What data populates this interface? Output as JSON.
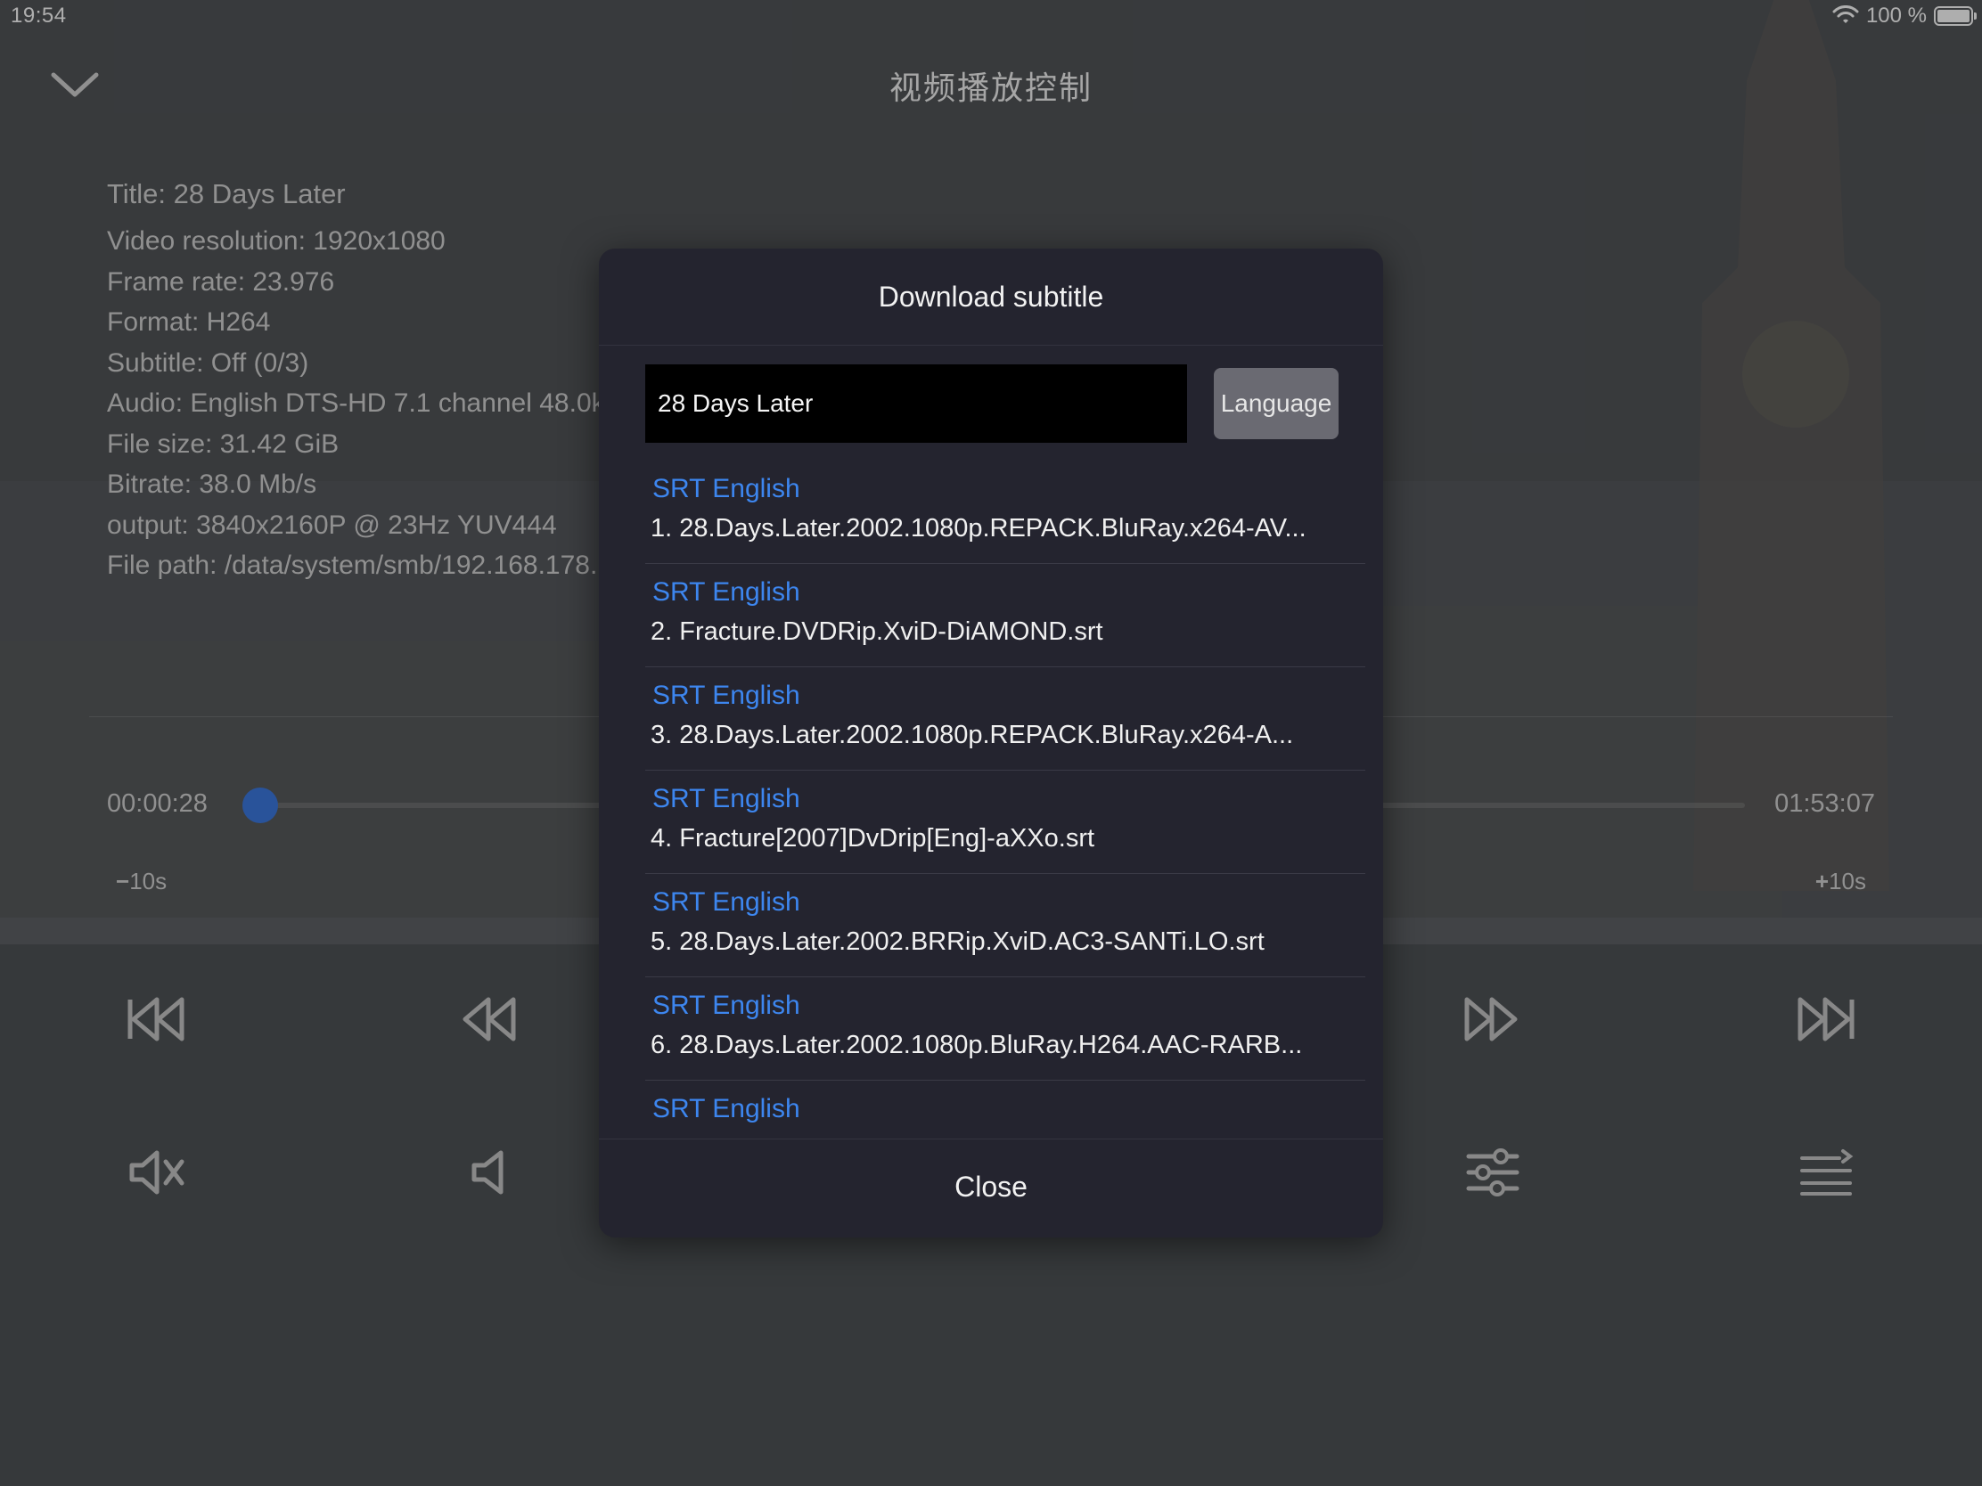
{
  "status_bar": {
    "time": "19:54",
    "battery_text": "100 %"
  },
  "header": {
    "title": "视频播放控制"
  },
  "info": {
    "title": "Title: 28 Days Later",
    "lines": [
      "Video resolution: 1920x1080",
      "Frame rate: 23.976",
      "Format: H264",
      "Subtitle: Off (0/3)",
      "Audio: English DTS-HD 7.1 channel 48.0k",
      "File size: 31.42 GiB",
      "Bitrate: 38.0 Mb/s",
      "output: 3840x2160P @ 23Hz  YUV444",
      "File path: /data/system/smb/192.168.178."
    ]
  },
  "playback": {
    "current_time": "00:00:28",
    "total_time": "01:53:07",
    "skip_back_label": "10s",
    "skip_forward_label": "10s",
    "progress_fraction": 0.0041
  },
  "modal": {
    "title": "Download subtitle",
    "search_value": "28 Days Later",
    "language_button": "Language",
    "close_button": "Close",
    "results": [
      {
        "type": "SRT English",
        "file": "1. 28.Days.Later.2002.1080p.REPACK.BluRay.x264-AV..."
      },
      {
        "type": "SRT English",
        "file": "2. Fracture.DVDRip.XviD-DiAMOND.srt"
      },
      {
        "type": "SRT English",
        "file": "3. 28.Days.Later.2002.1080p.REPACK.BluRay.x264-A..."
      },
      {
        "type": "SRT English",
        "file": "4. Fracture[2007]DvDrip[Eng]-aXXo.srt"
      },
      {
        "type": "SRT English",
        "file": "5. 28.Days.Later.2002.BRRip.XviD.AC3-SANTi.LO.srt"
      },
      {
        "type": "SRT English",
        "file": "6. 28.Days.Later.2002.1080p.BluRay.H264.AAC-RARB..."
      },
      {
        "type": "SRT English",
        "file": ""
      }
    ]
  },
  "colors": {
    "accent": "#3d86ef",
    "modal_bg": "#24242f",
    "progress_thumb": "#3a73d6"
  }
}
